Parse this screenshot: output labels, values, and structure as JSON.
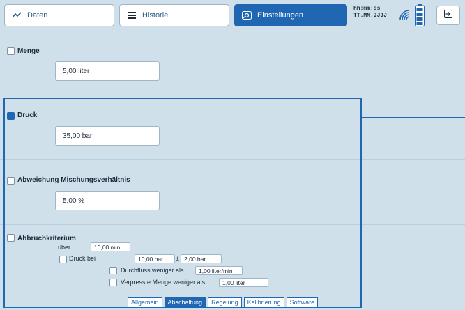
{
  "tabs": [
    {
      "label": "Daten",
      "icon": "chart-line-icon"
    },
    {
      "label": "Historie",
      "icon": "list-icon"
    },
    {
      "label": "Einstellungen",
      "icon": "settings-icon",
      "active": true
    }
  ],
  "status": {
    "time_format": "hh:mm:ss",
    "date_format": "TT.MM.JJJJ",
    "signal_icon": "wireless-icon",
    "battery_icon": "battery-icon"
  },
  "exit_icon": "exit-icon",
  "sections": {
    "menge": {
      "label": "Menge",
      "checked": false,
      "value": "5,00 liter"
    },
    "druck": {
      "label": "Druck",
      "checked": true,
      "value": "35,00 bar"
    },
    "abweichung": {
      "label": "Abweichung Mischungsverhältnis",
      "checked": false,
      "value": "5,00 %"
    },
    "abbruch": {
      "label": "Abbruchkriterium",
      "checked": false,
      "ueber_label": "über",
      "ueber_value": "10,00 min",
      "druck_bei_label": "Druck bei",
      "druck_bei_value": "10,00 bar",
      "tolerance_prefix": "±",
      "tolerance_value": "2,00 bar",
      "durchfluss_label": "Durchfluss weniger als",
      "durchfluss_value": "1,00 liter/min",
      "verpresst_label": "Verpresste Menge weniger als",
      "verpresst_value": "1,00 liter"
    }
  },
  "subtabs": [
    {
      "label": "Allgemein",
      "active": false
    },
    {
      "label": "Abschaltung",
      "active": true
    },
    {
      "label": "Regelung",
      "active": false
    },
    {
      "label": "Kalibrierung",
      "active": false
    },
    {
      "label": "Software",
      "active": false
    }
  ],
  "colors": {
    "accent": "#1f66b3",
    "background": "#cfe0eb"
  }
}
